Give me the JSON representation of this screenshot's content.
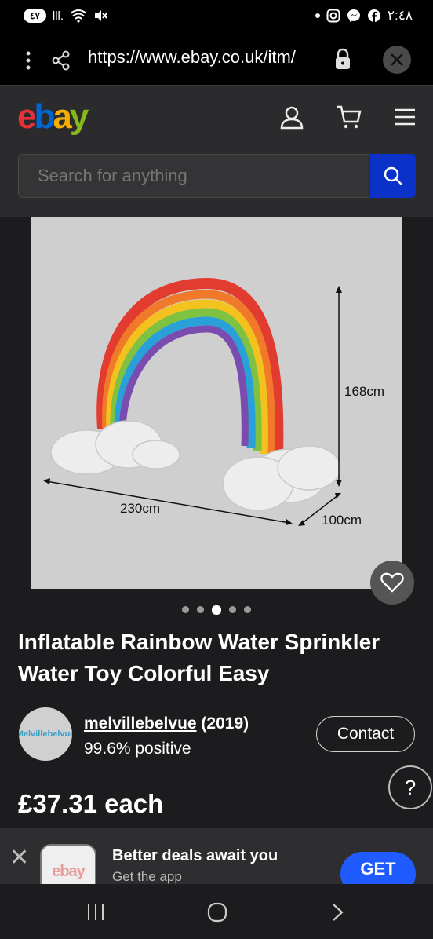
{
  "status_bar": {
    "left_badge": "٤٧",
    "signal": "lll.",
    "time": "٢:٤٨"
  },
  "url_bar": {
    "url": "https://www.ebay.co.uk/itm/"
  },
  "header": {
    "search_placeholder": "Search for anything"
  },
  "product": {
    "image_labels": {
      "height": "168cm",
      "width": "230cm",
      "depth": "100cm"
    },
    "image_count": 5,
    "active_image": 3,
    "title": "Inflatable Rainbow Water Sprinkler Water Toy Colorful Easy",
    "seller": {
      "name": "melvillebelvue",
      "feedback_count": " (2019)",
      "positive": "99.6% positive",
      "avatar_text": "Melvillebelvue"
    },
    "contact_label": "Contact",
    "price": "£37.31 each"
  },
  "app_banner": {
    "icon_text": "ebay",
    "headline": "Better deals await you",
    "subline": "Get the app",
    "get_label": "GET"
  },
  "colors": {
    "search_button": "#0a32c8",
    "get_button": "#1f5bff",
    "background": "#1c1c1e",
    "header": "#2b2b2d"
  }
}
